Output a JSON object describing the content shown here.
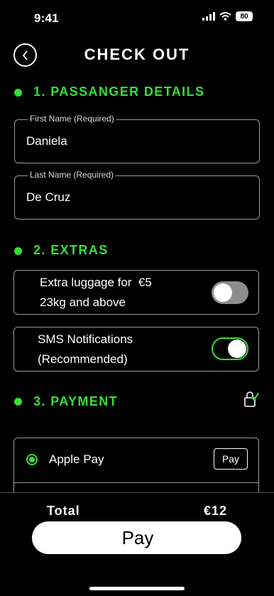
{
  "status_bar": {
    "time": "9:41",
    "battery": "80"
  },
  "header": {
    "title": "CHECK OUT"
  },
  "sections": {
    "passenger": {
      "title": "1. PASSANGER DETAILS"
    },
    "extras": {
      "title": "2. EXTRAS"
    },
    "payment": {
      "title": "3. PAYMENT"
    }
  },
  "passenger": {
    "first_name": {
      "label": "First Name (Required)",
      "value": "Daniela"
    },
    "last_name": {
      "label": "Last Name (Required)",
      "value": "De Cruz"
    }
  },
  "extras": {
    "luggage": {
      "line1": "Extra luggage for  €5",
      "line2": "23kg and above",
      "enabled": false
    },
    "sms": {
      "line1": "SMS Notifications",
      "line2": "(Recommended)",
      "enabled": true
    }
  },
  "payment": {
    "selected": "Apple Pay",
    "apple_pay_label": "Apple Pay",
    "badge": {
      "apple": "",
      "text": "Pay"
    }
  },
  "checkout": {
    "total_label": "Total",
    "total_value": "€12",
    "pay_button": {
      "apple": "",
      "text": "Pay"
    }
  },
  "colors": {
    "accent": "#33e033",
    "background": "#000000",
    "border": "#9a9a9a"
  }
}
